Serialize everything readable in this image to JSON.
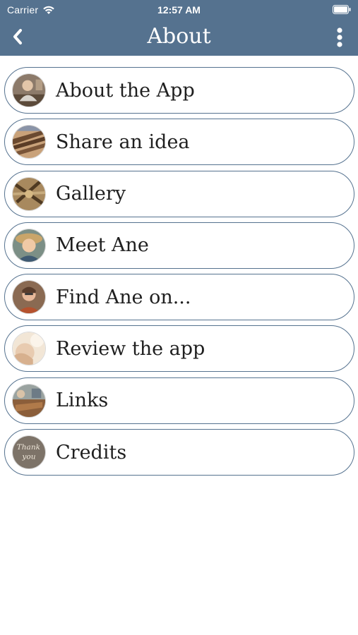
{
  "status_bar": {
    "carrier": "Carrier",
    "time": "12:57 AM",
    "wifi_icon": "wifi-icon",
    "battery_icon": "battery-icon"
  },
  "nav": {
    "title": "About",
    "back_icon": "chevron-left-icon",
    "more_icon": "more-vertical-icon"
  },
  "colors": {
    "header_bg": "#55728f",
    "item_border": "#55728f",
    "text": "#1f1f1f"
  },
  "menu": {
    "items": [
      {
        "label": "About the App",
        "icon": "about-app-avatar"
      },
      {
        "label": "Share an idea",
        "icon": "share-idea-avatar"
      },
      {
        "label": "Gallery",
        "icon": "gallery-avatar"
      },
      {
        "label": "Meet Ane",
        "icon": "meet-ane-avatar"
      },
      {
        "label": "Find Ane on...",
        "icon": "find-ane-avatar"
      },
      {
        "label": "Review the app",
        "icon": "review-app-avatar"
      },
      {
        "label": "Links",
        "icon": "links-avatar"
      },
      {
        "label": "Credits",
        "icon": "credits-avatar",
        "image_text": "thank you"
      }
    ]
  }
}
